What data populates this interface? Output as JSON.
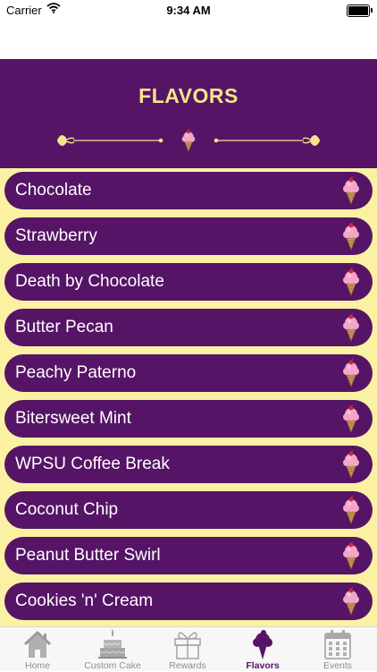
{
  "status_bar": {
    "carrier": "Carrier",
    "time": "9:34 AM"
  },
  "header": {
    "title": "FLAVORS"
  },
  "flavors": [
    {
      "label": "Chocolate"
    },
    {
      "label": "Strawberry"
    },
    {
      "label": "Death by Chocolate"
    },
    {
      "label": "Butter Pecan"
    },
    {
      "label": "Peachy Paterno"
    },
    {
      "label": "Bitersweet Mint"
    },
    {
      "label": "WPSU Coffee Break"
    },
    {
      "label": "Coconut Chip"
    },
    {
      "label": "Peanut Butter Swirl"
    },
    {
      "label": "Cookies 'n' Cream"
    }
  ],
  "tabs": [
    {
      "label": "Home",
      "icon": "house-icon"
    },
    {
      "label": "Custom Cake",
      "icon": "cake-icon"
    },
    {
      "label": "Rewards",
      "icon": "gift-icon"
    },
    {
      "label": "Flavors",
      "icon": "ice-cream-icon",
      "active": true
    },
    {
      "label": "Events",
      "icon": "calendar-icon"
    }
  ],
  "colors": {
    "primary": "#561466",
    "accent": "#f7e48a",
    "list_bg": "#fbf1a2",
    "inactive_tab": "#8e8e93"
  }
}
